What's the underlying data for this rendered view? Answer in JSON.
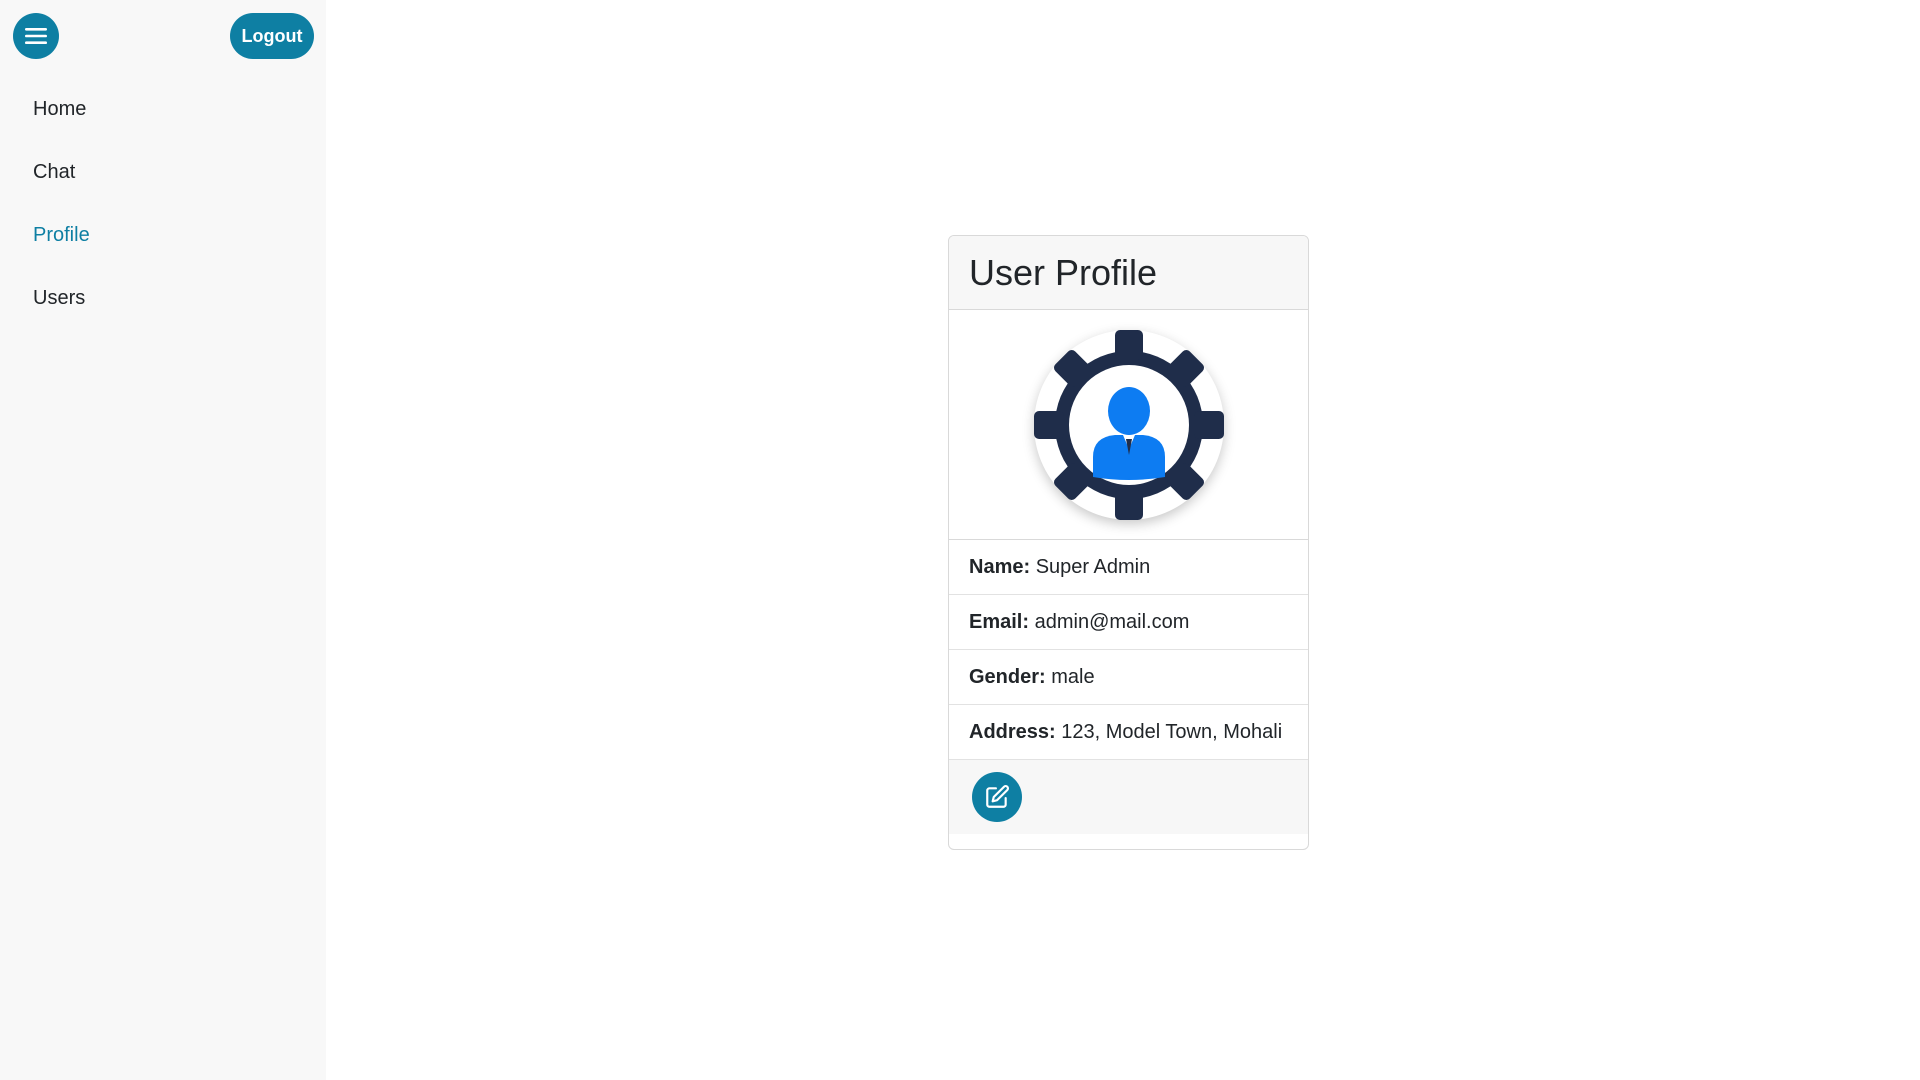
{
  "sidebar": {
    "menu_icon": "hamburger-icon",
    "logout_label": "Logout",
    "items": [
      {
        "label": "Home"
      },
      {
        "label": "Chat"
      },
      {
        "label": "Profile"
      },
      {
        "label": "Users"
      }
    ],
    "active": "Profile"
  },
  "profile": {
    "title": "User Profile",
    "avatar_icon": "user-gear-icon",
    "fields": [
      {
        "label": "Name:",
        "value": "Super Admin"
      },
      {
        "label": "Email:",
        "value": "admin@mail.com"
      },
      {
        "label": "Gender:",
        "value": "male"
      },
      {
        "label": "Address:",
        "value": "123, Model Town, Mohali"
      }
    ],
    "edit_icon": "edit-icon"
  },
  "colors": {
    "accent": "#0e7fa3",
    "gear": "#1f2d4a",
    "user": "#0d7cf2",
    "sidebar_bg": "#f8f8f8"
  }
}
